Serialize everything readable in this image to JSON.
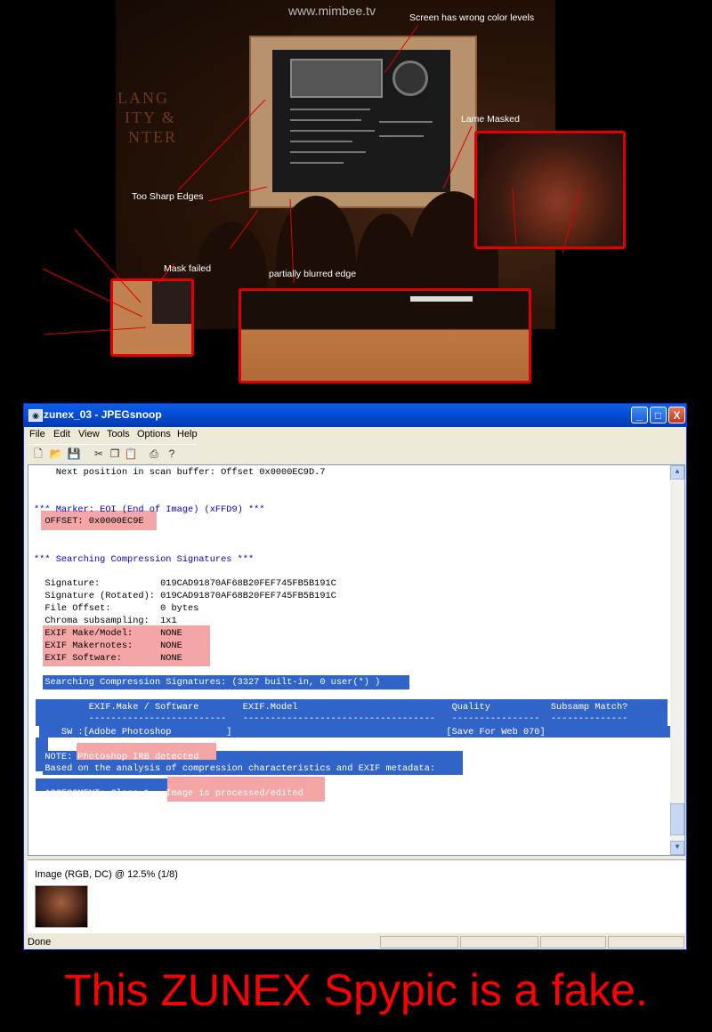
{
  "photo": {
    "watermark": "www.mimbee.tv",
    "annotations": {
      "wrong_color": "Screen has wrong color levels",
      "lame_masked": "Lame Masked",
      "sharp_edges": "Too Sharp Edges",
      "mask_failed": "Mask failed",
      "blurred_edge": "partially blurred edge"
    },
    "wall_text": [
      "LANG",
      "ITY &",
      "NTER"
    ],
    "annotation_color": "#e00000"
  },
  "window": {
    "title": "zunex_03 - JPEGsnoop",
    "controls": {
      "minimize": "_",
      "maximize": "□",
      "close": "X"
    },
    "menu": [
      "File",
      "Edit",
      "View",
      "Tools",
      "Options",
      "Help"
    ],
    "toolbar_icons": [
      "new-icon",
      "open-icon",
      "save-icon",
      "cut-icon",
      "copy-icon",
      "paste-icon",
      "print-icon",
      "help-icon"
    ],
    "log": {
      "scan_buffer": "    Next position in scan buffer: Offset 0x0000EC9D.7",
      "marker_eoi": "*** Marker: EOI (End of Image) (xFFD9) ***",
      "offset": "  OFFSET: 0x0000EC9E",
      "search_header": "*** Searching Compression Signatures ***",
      "signature": "  Signature:           019CAD91870AF68B20FEF745FB5B191C",
      "signature_rot": "  Signature (Rotated): 019CAD91870AF68B20FEF745FB5B191C",
      "file_offset": "  File Offset:         0 bytes",
      "chroma": "  Chroma subsampling:  1x1",
      "exif_make": "  EXIF Make/Model:     NONE",
      "exif_maker": "  EXIF Makernotes:     NONE",
      "exif_soft": "  EXIF Software:       NONE",
      "searching": "  Searching Compression Signatures: (3327 built-in, 0 user(*) )",
      "table_header": "          EXIF.Make / Software        EXIF.Model                            Quality           Subsamp Match?",
      "table_rule": "          -------------------------   -----------------------------------   ----------------  --------------",
      "table_row": "     SW :[Adobe Photoshop          ]                                       [Save For Web 070]",
      "note": "  NOTE: Photoshop IRB detected",
      "based_on": "  Based on the analysis of compression characteristics and EXIF metadata:",
      "assessment": "  ASSESSMENT: Class 1 - Image is processed/edited"
    },
    "image_caption": "Image (RGB, DC) @ 12.5% (1/8)",
    "status": "Done",
    "highlight_pink": "#f4a6a6",
    "highlight_blue": "#3164c9"
  },
  "headline": "This ZUNEX Spypic is a fake."
}
